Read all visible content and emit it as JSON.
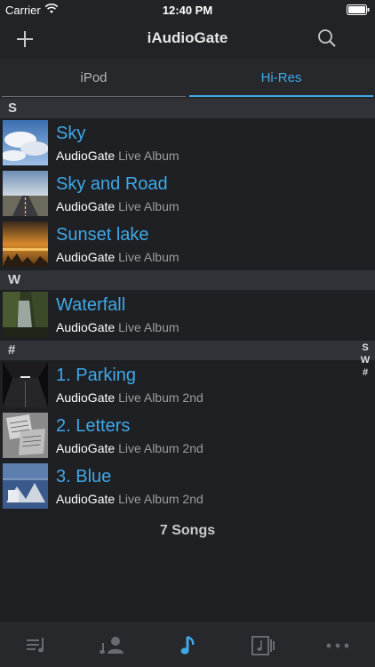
{
  "status_bar": {
    "carrier": "Carrier",
    "time": "12:40 PM"
  },
  "nav": {
    "title": "iAudioGate",
    "add_icon": "plus-icon",
    "search_icon": "search-icon"
  },
  "tabs": [
    {
      "label": "iPod",
      "active": false
    },
    {
      "label": "Hi-Res",
      "active": true
    }
  ],
  "sections": [
    {
      "letter": "S"
    },
    {
      "letter": "W"
    },
    {
      "letter": "#"
    }
  ],
  "songs": [
    {
      "title": "Sky",
      "artist": "AudioGate",
      "album": "Live Album"
    },
    {
      "title": "Sky and Road",
      "artist": "AudioGate",
      "album": "Live Album"
    },
    {
      "title": "Sunset lake",
      "artist": "AudioGate",
      "album": "Live Album"
    },
    {
      "title": "Waterfall",
      "artist": "AudioGate",
      "album": "Live Album"
    },
    {
      "title": "1. Parking",
      "artist": "AudioGate",
      "album": "Live Album 2nd"
    },
    {
      "title": "2. Letters",
      "artist": "AudioGate",
      "album": "Live Album 2nd"
    },
    {
      "title": "3. Blue",
      "artist": "AudioGate",
      "album": "Live Album 2nd"
    }
  ],
  "index": [
    "S",
    "W",
    "#"
  ],
  "song_count": "7 Songs",
  "tab_bar": [
    {
      "icon": "playlist-icon",
      "active": false
    },
    {
      "icon": "artist-icon",
      "active": false
    },
    {
      "icon": "music-note-icon",
      "active": true
    },
    {
      "icon": "album-icon",
      "active": false
    },
    {
      "icon": "more-icon",
      "active": false
    }
  ],
  "colors": {
    "accent": "#3fa9e8",
    "background": "#1f2024",
    "section_header": "#313237"
  }
}
